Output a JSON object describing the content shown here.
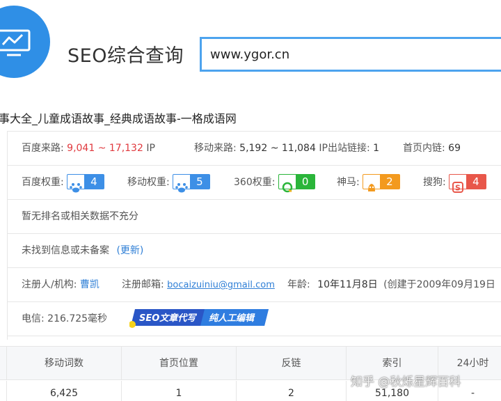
{
  "header": {
    "app_title": "SEO综合查询",
    "search_value": "www.ygor.cn"
  },
  "site_title": "事大全_儿童成语故事_经典成语故事-一格成语网",
  "traffic": {
    "baidu_label": "百度来路:",
    "baidu_range": "9,041 ~ 17,132",
    "baidu_unit": "IP",
    "mobile_label": "移动来路:",
    "mobile_range": "5,192 ~ 11,084",
    "mobile_unit": "IP",
    "outlinks_label": "出站链接:",
    "outlinks_value": "1",
    "homelinks_label": "首页内链:",
    "homelinks_value": "69"
  },
  "weights": {
    "baidu_label": "百度权重:",
    "baidu_value": "4",
    "mobile_label": "移动权重:",
    "mobile_value": "5",
    "w360_label": "360权重:",
    "w360_value": "0",
    "shenma_label": "神马:",
    "shenma_value": "2",
    "sogou_label": "搜狗:",
    "sogou_value": "4"
  },
  "ranking_note": "暂无排名或相关数据不充分",
  "beian": {
    "text": "未找到信息或未备案",
    "update_link": "(更新)"
  },
  "whois": {
    "registrant_label": "注册人/机构:",
    "registrant_value": "曹凯",
    "email_label": "注册邮箱:",
    "email_value": "bocaizuiniu@gmail.com",
    "age_label": "年龄:",
    "age_value": "10年11月8日",
    "created_text": "(创建于2009年09月19日"
  },
  "telecom": {
    "text": "电信: 216.725毫秒",
    "promo_left": "SEO文章代写",
    "promo_right": "纯人工编辑"
  },
  "table": {
    "headers": [
      "移动词数",
      "首页位置",
      "反链",
      "索引",
      "24小时"
    ],
    "row": [
      "6,425",
      "1",
      "2",
      "51,180",
      "-"
    ]
  },
  "watermark": "知乎 @秋烁星辉百科",
  "colors": {
    "accent_blue": "#2f8fe6",
    "range_red": "#e0393e",
    "badge_baidu": "#3d8fe6",
    "badge_360": "#2ab53a",
    "badge_shenma": "#f39a1e",
    "badge_sogou": "#e8574a"
  }
}
